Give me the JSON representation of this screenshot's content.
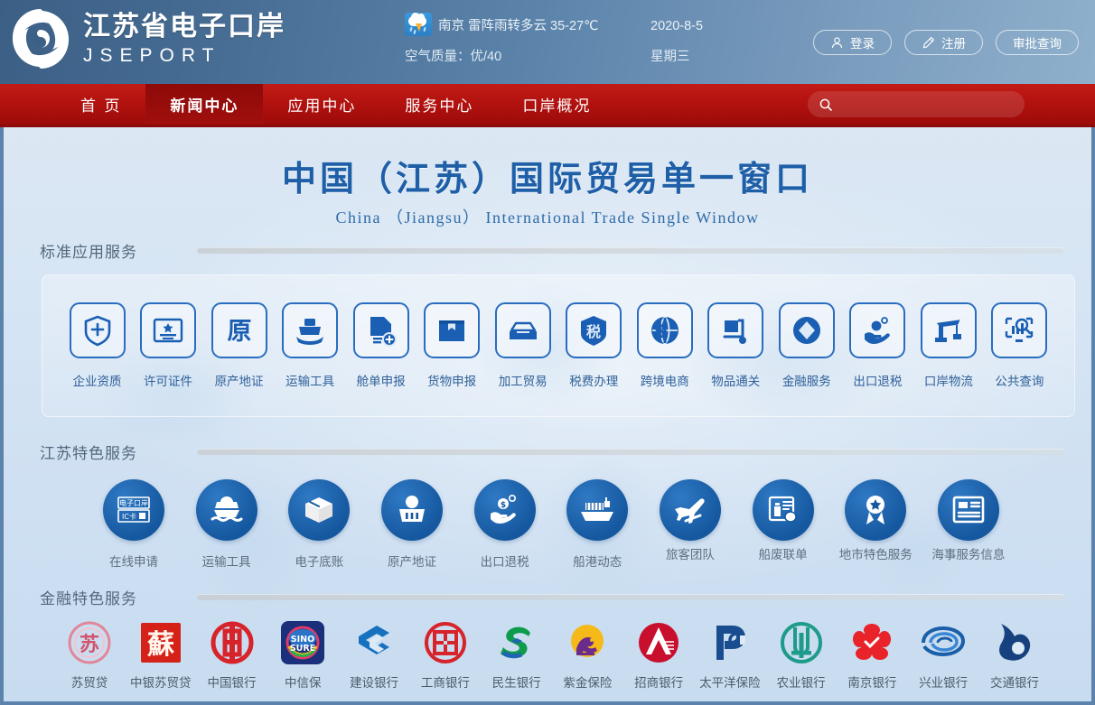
{
  "header": {
    "logo_cn": "江苏省电子口岸",
    "logo_en": "JSEPORT",
    "weather": {
      "city": "南京",
      "condition": "雷阵雨转多云 35-27℃",
      "summary": "南京  雷阵雨转多云 35-27℃",
      "air_quality": "空气质量：优/40"
    },
    "date": "2020-8-5",
    "weekday": "星期三",
    "buttons": [
      {
        "label": "登录",
        "icon": "user-icon"
      },
      {
        "label": "注册",
        "icon": "pencil-icon"
      },
      {
        "label": "审批查询",
        "icon": "none"
      }
    ]
  },
  "nav": {
    "items": [
      {
        "label": "首 页",
        "active": false
      },
      {
        "label": "新闻中心",
        "active": true
      },
      {
        "label": "应用中心",
        "active": false
      },
      {
        "label": "服务中心",
        "active": false
      },
      {
        "label": "口岸概况",
        "active": false
      }
    ],
    "search": {
      "value": "",
      "placeholder": "",
      "icon": "search-icon"
    }
  },
  "banner": {
    "title_cn": "中国（江苏）国际贸易单一窗口",
    "title_en": "China （Jiangsu） International Trade Single Window"
  },
  "sections": {
    "standard": {
      "label": "标准应用服务",
      "items": [
        {
          "label": "企业资质",
          "icon": "shield-plus-icon"
        },
        {
          "label": "许可证件",
          "icon": "certificate-icon"
        },
        {
          "label": "原产地证",
          "icon": "origin-character-icon"
        },
        {
          "label": "运输工具",
          "icon": "ship-icon"
        },
        {
          "label": "舱单申报",
          "icon": "document-add-icon"
        },
        {
          "label": "货物申报",
          "icon": "package-icon"
        },
        {
          "label": "加工贸易",
          "icon": "tray-icon"
        },
        {
          "label": "税费办理",
          "icon": "tax-character-icon"
        },
        {
          "label": "跨境电商",
          "icon": "globe-dollar-icon"
        },
        {
          "label": "物品通关",
          "icon": "handcart-icon"
        },
        {
          "label": "金融服务",
          "icon": "coin-diamond-icon"
        },
        {
          "label": "出口退税",
          "icon": "hand-coin-icon"
        },
        {
          "label": "口岸物流",
          "icon": "crane-icon"
        },
        {
          "label": "公共查询",
          "icon": "monitor-search-icon"
        }
      ]
    },
    "jiangsu": {
      "label": "江苏特色服务",
      "items": [
        {
          "label": "在线申请",
          "icon": "ic-card-icon",
          "card_line1": "电子口岸",
          "card_line2": "IC卡"
        },
        {
          "label": "运输工具",
          "icon": "boat-wave-icon"
        },
        {
          "label": "电子底账",
          "icon": "box-icon"
        },
        {
          "label": "原产地证",
          "icon": "basket-icon"
        },
        {
          "label": "出口退税",
          "icon": "hand-coin-icon"
        },
        {
          "label": "船港动态",
          "icon": "cargo-ship-icon"
        },
        {
          "label": "旅客团队",
          "icon": "airplane-icon"
        },
        {
          "label": "船废联单",
          "icon": "clipboard-trash-icon"
        },
        {
          "label": "地市特色服务",
          "icon": "medal-star-icon"
        },
        {
          "label": "海事服务信息",
          "icon": "news-card-icon"
        }
      ]
    },
    "financial": {
      "label": "金融特色服务",
      "items": [
        {
          "label": "苏贸贷",
          "logo": "sumaodai-logo",
          "color": "#d4536a"
        },
        {
          "label": "中银苏贸贷",
          "logo": "su-seal-logo",
          "color": "#d62118"
        },
        {
          "label": "中国银行",
          "logo": "boc-logo",
          "color": "#d7232a"
        },
        {
          "label": "中信保",
          "logo": "sinosure-logo",
          "color": "#1b2f7a"
        },
        {
          "label": "建设银行",
          "logo": "ccb-logo",
          "color": "#1771bf"
        },
        {
          "label": "工商银行",
          "logo": "icbc-logo",
          "color": "#d7232a"
        },
        {
          "label": "民生银行",
          "logo": "cmbc-logo",
          "color": "#0f9b4c"
        },
        {
          "label": "紫金保险",
          "logo": "zijin-logo",
          "color": "#f5b919"
        },
        {
          "label": "招商银行",
          "logo": "cmb-logo",
          "color": "#c8102e"
        },
        {
          "label": "太平洋保险",
          "logo": "cpic-logo",
          "color": "#1a4d8f"
        },
        {
          "label": "农业银行",
          "logo": "abc-logo",
          "color": "#1e9b8a"
        },
        {
          "label": "南京银行",
          "logo": "njbank-logo",
          "color": "#e8242a"
        },
        {
          "label": "兴业银行",
          "logo": "cib-logo",
          "color": "#1a5fa8"
        },
        {
          "label": "交通银行",
          "logo": "bocom-logo",
          "color": "#17407f"
        }
      ]
    }
  },
  "colors": {
    "header_blue": "#5b83ab",
    "nav_red": "#b0110e",
    "nav_active_red": "#8e0a09",
    "title_blue": "#1e5fa8",
    "icon_blue": "#2a6dc0",
    "circle_blue": "#15589f"
  }
}
